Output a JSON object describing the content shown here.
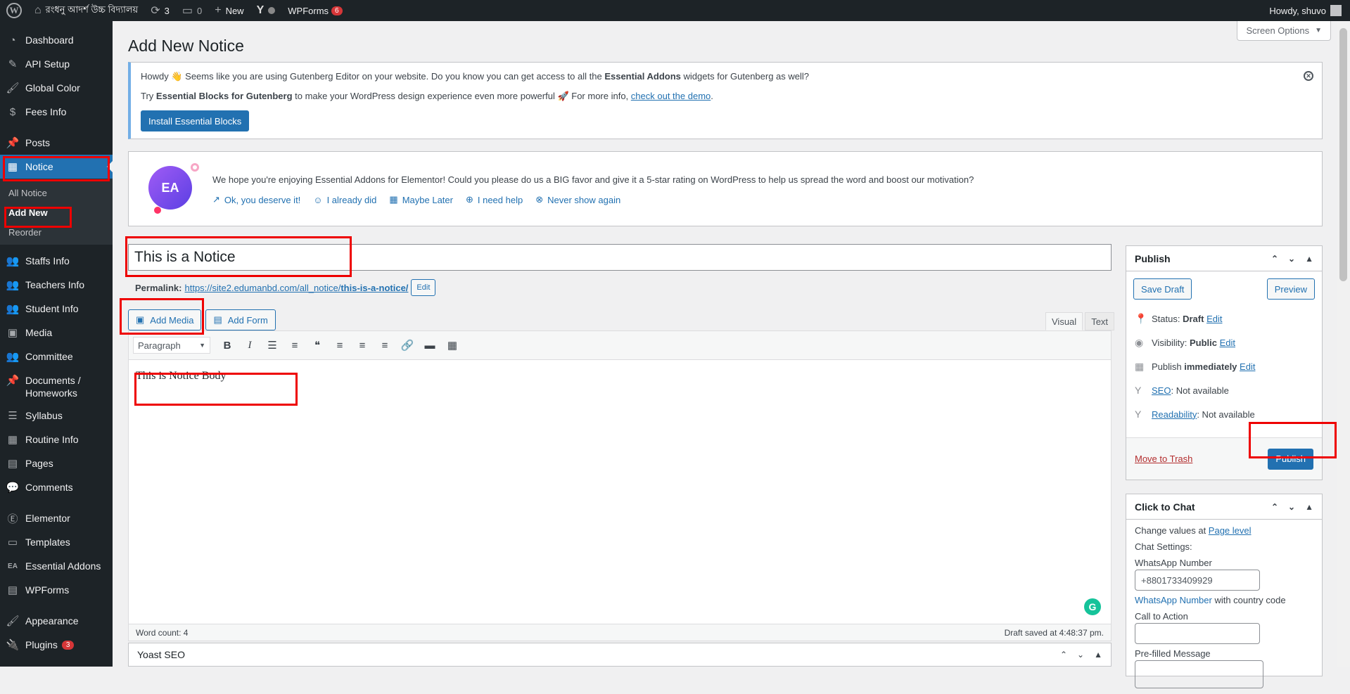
{
  "admin_bar": {
    "site_name": "রংধনু আদর্শ উচ্চ বিদ্যালয়",
    "updates_count": "3",
    "comments_count": "0",
    "new_label": "New",
    "wpforms_label": "WPForms",
    "wpforms_count": "6",
    "howdy": "Howdy, shuvo"
  },
  "sidebar": {
    "items": [
      {
        "label": "Dashboard",
        "icon": "dashboard-icon"
      },
      {
        "label": "API Setup",
        "icon": "wrench-icon"
      },
      {
        "label": "Global Color",
        "icon": "brush-icon"
      },
      {
        "label": "Fees Info",
        "icon": "dollar-icon"
      },
      {
        "label": "Posts",
        "icon": "pin-icon"
      },
      {
        "label": "Notice",
        "icon": "calendar-icon"
      },
      {
        "label": "Staffs Info",
        "icon": "users-icon"
      },
      {
        "label": "Teachers Info",
        "icon": "users-icon"
      },
      {
        "label": "Student Info",
        "icon": "users-icon"
      },
      {
        "label": "Media",
        "icon": "media-icon"
      },
      {
        "label": "Committee",
        "icon": "users-icon"
      },
      {
        "label": "Documents / Homeworks",
        "icon": "pin-icon"
      },
      {
        "label": "Syllabus",
        "icon": "list-icon"
      },
      {
        "label": "Routine Info",
        "icon": "calendar-icon"
      },
      {
        "label": "Pages",
        "icon": "pages-icon"
      },
      {
        "label": "Comments",
        "icon": "comment-icon"
      },
      {
        "label": "Elementor",
        "icon": "elementor-icon"
      },
      {
        "label": "Templates",
        "icon": "folder-icon"
      },
      {
        "label": "Essential Addons",
        "icon": "ea-icon"
      },
      {
        "label": "WPForms",
        "icon": "form-icon"
      },
      {
        "label": "Appearance",
        "icon": "brush-icon"
      },
      {
        "label": "Plugins",
        "icon": "plug-icon",
        "badge": "3"
      }
    ],
    "submenu": [
      "All Notice",
      "Add New",
      "Reorder"
    ]
  },
  "screen_options": "Screen Options",
  "page_title": "Add New Notice",
  "notice_gutenberg": {
    "line1_a": "Howdy 👋 Seems like you are using Gutenberg Editor on your website. Do you know you can get access to all the ",
    "line1_b": "Essential Addons",
    "line1_c": " widgets for Gutenberg as well?",
    "line2_a": "Try ",
    "line2_b": "Essential Blocks for Gutenberg",
    "line2_c": " to make your WordPress design experience even more powerful 🚀 For more info, ",
    "line2_link": "check out the demo",
    "line2_d": ".",
    "button": "Install Essential Blocks"
  },
  "notice_rating": {
    "message": "We hope you're enjoying Essential Addons for Elementor! Could you please do us a BIG favor and give it a 5-star rating on WordPress to help us spread the word and boost our motivation?",
    "links": [
      "Ok, you deserve it!",
      "I already did",
      "Maybe Later",
      "I need help",
      "Never show again"
    ]
  },
  "editor": {
    "title": "This is a Notice",
    "permalink_label": "Permalink:",
    "permalink_base": "https://site2.edumanbd.com/all_notice/",
    "permalink_slug": "this-is-a-notice/",
    "edit_label": "Edit",
    "add_media": "Add Media",
    "add_form": "Add Form",
    "tab_visual": "Visual",
    "tab_text": "Text",
    "format": "Paragraph",
    "body": "This is Notice Body",
    "word_count": "Word count: 4",
    "draft_saved": "Draft saved at 4:48:37 pm."
  },
  "yoast": {
    "title": "Yoast SEO"
  },
  "publish_box": {
    "title": "Publish",
    "save_draft": "Save Draft",
    "preview": "Preview",
    "status_label": "Status:",
    "status_value": "Draft",
    "visibility_label": "Visibility:",
    "visibility_value": "Public",
    "publish_label": "Publish",
    "publish_value": "immediately",
    "edit": "Edit",
    "seo_link": "SEO",
    "seo_value": ": Not available",
    "readability_link": "Readability",
    "readability_value": ": Not available",
    "trash": "Move to Trash",
    "publish_button": "Publish"
  },
  "chat_box": {
    "title": "Click to Chat",
    "change_values": "Change values at ",
    "page_level": "Page level",
    "chat_settings": "Chat Settings:",
    "whatsapp_label": "WhatsApp Number",
    "whatsapp_value": "+8801733409929",
    "whatsapp_hint_link": "WhatsApp Number",
    "whatsapp_hint": " with country code",
    "cta_label": "Call to Action",
    "prefilled_label": "Pre-filled Message"
  },
  "colors": {
    "admin_dark": "#1d2327",
    "accent": "#2271b1",
    "highlight": "#ee0000"
  }
}
